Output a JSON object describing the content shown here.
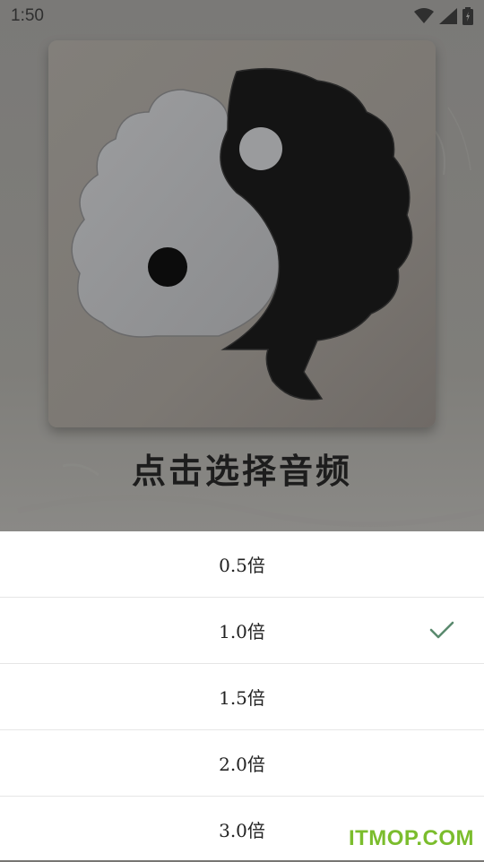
{
  "status_bar": {
    "time": "1:50"
  },
  "hero": {
    "title": "点击选择音频"
  },
  "speed_sheet": {
    "options": [
      {
        "label": "0.5倍",
        "selected": false
      },
      {
        "label": "1.0倍",
        "selected": true
      },
      {
        "label": "1.5倍",
        "selected": false
      },
      {
        "label": "2.0倍",
        "selected": false
      },
      {
        "label": "3.0倍",
        "selected": false
      }
    ]
  },
  "watermark": {
    "text": "ITMOP.COM"
  },
  "colors": {
    "check": "#5a8a6e",
    "watermark": "#7bbd2d"
  }
}
